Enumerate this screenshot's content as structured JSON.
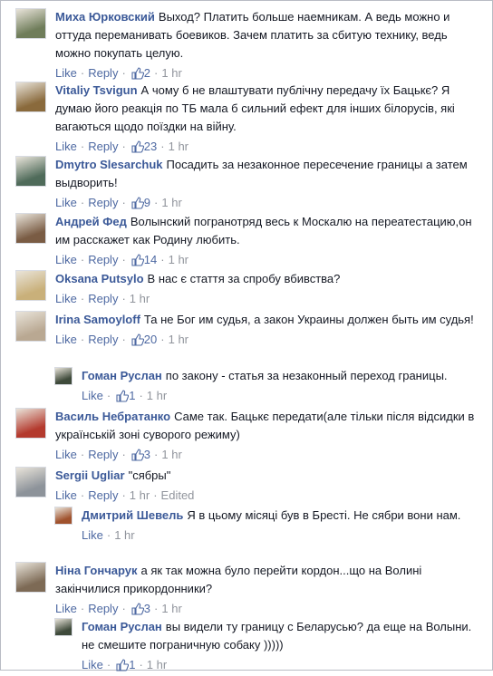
{
  "actions": {
    "like": "Like",
    "reply": "Reply",
    "dot": "·"
  },
  "comments": [
    {
      "author": "Миха Юрковский",
      "text": "Выход? Платить больше наемникам. А ведь можно и оттуда переманивать боевиков. Зачем платить за сбитую технику, ведь можно покупать целую.",
      "likes": "2",
      "time": "1 hr",
      "avatar_color": "#6f7d5a"
    },
    {
      "author": "Vitaliy Tsvigun",
      "text": "А чому б не влаштувати публічну передачу їх Бацькє? Я думаю його реакція по ТБ мала б сильний ефект для інших білорусів, які вагаються щодо поїздки на війну.",
      "likes": "23",
      "time": "1 hr",
      "avatar_color": "#8a6a3c"
    },
    {
      "author": "Dmytro Slesarchuk",
      "text": "Посадить за незаконное пересечение границы а затем выдворить!",
      "likes": "9",
      "time": "1 hr",
      "avatar_color": "#4f6b5a"
    },
    {
      "author": "Андрей Фед",
      "text": "Волынский погранотряд весь к Москалю на переатестацию,он им расскажет как Родину любить.",
      "likes": "14",
      "time": "1 hr",
      "avatar_color": "#7a5c44"
    },
    {
      "author": "Oksana Putsylo",
      "text": "В нас є стаття за спробу вбивства?",
      "likes": "",
      "time": "1 hr",
      "avatar_color": "#c9b07a"
    },
    {
      "author": "Irina Samoyloff",
      "text": "Та не Бог им судья, а закон Украины должен быть им судья!",
      "likes": "20",
      "time": "1 hr",
      "avatar_color": "#b9a892"
    },
    {
      "author": "Гоман Руслан",
      "text": "по закону - статья за незаконный переход границы.",
      "likes": "1",
      "time": "1 hr",
      "avatar_color": "#3e4a3a",
      "reply": true
    },
    {
      "author": "Василь Небратанко",
      "text": "Саме так. Бацькє передати(але тільки після відсидки в українській зоні суворого режиму)",
      "likes": "3",
      "time": "1 hr",
      "avatar_color": "#b43a2e"
    },
    {
      "author": "Sergii Ugliar",
      "text": "\"сябры\"",
      "likes": "",
      "time": "1 hr",
      "edited": "Edited",
      "avatar_color": "#8d939a"
    },
    {
      "author": "Дмитрий Шевель",
      "text": "Я в цьому місяці був в Бресті. Не сябри вони нам.",
      "likes": "",
      "time": "1 hr",
      "avatar_color": "#a0522d",
      "reply": true
    },
    {
      "author": "Ніна Гончарук",
      "text": "а як так можна було перейти кордон...що на Волині закінчилися прикордонники?",
      "likes": "3",
      "time": "1 hr",
      "avatar_color": "#7d6a55"
    },
    {
      "author": "Гоман Руслан",
      "text": "вы видели ту границу с Беларусью? да еще на Волыни. не смешите пограничную собаку )))))",
      "likes": "1",
      "time": "1 hr",
      "avatar_color": "#3e4a3a",
      "reply": true
    }
  ]
}
